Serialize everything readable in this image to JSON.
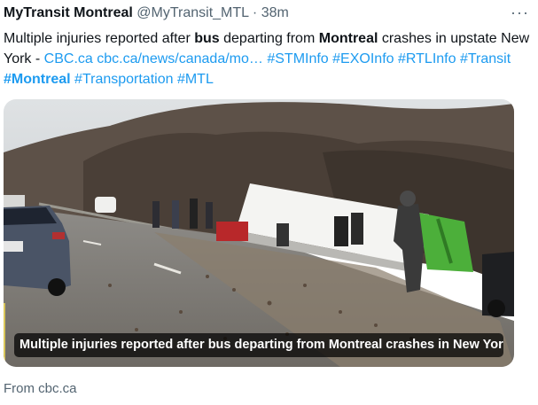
{
  "tweet": {
    "display_name": "MyTransit Montreal",
    "handle": "@MyTransit_MTL",
    "separator": "·",
    "time": "38m",
    "more": "···",
    "text_1": "Multiple injuries reported after ",
    "text_bold_1": "bus",
    "text_2": " departing from ",
    "text_bold_2": "Montreal",
    "text_3": " crashes in upstate New York - ",
    "link_1": "CBC.ca",
    "link_2": "cbc.ca/news/canada/mo…",
    "hashtags": [
      "#STMInfo",
      "#EXOInfo",
      "#RTLInfo",
      "#Transit",
      "#Montreal",
      "#Transportation",
      "#MTL"
    ]
  },
  "card": {
    "caption": "Multiple injuries reported after bus departing from Montreal crashes in New Yor…",
    "source": "From cbc.ca",
    "scene": "highway bus crash photo"
  },
  "colors": {
    "link": "#1d9bf0",
    "text": "#0f1419",
    "secondary": "#536471"
  }
}
